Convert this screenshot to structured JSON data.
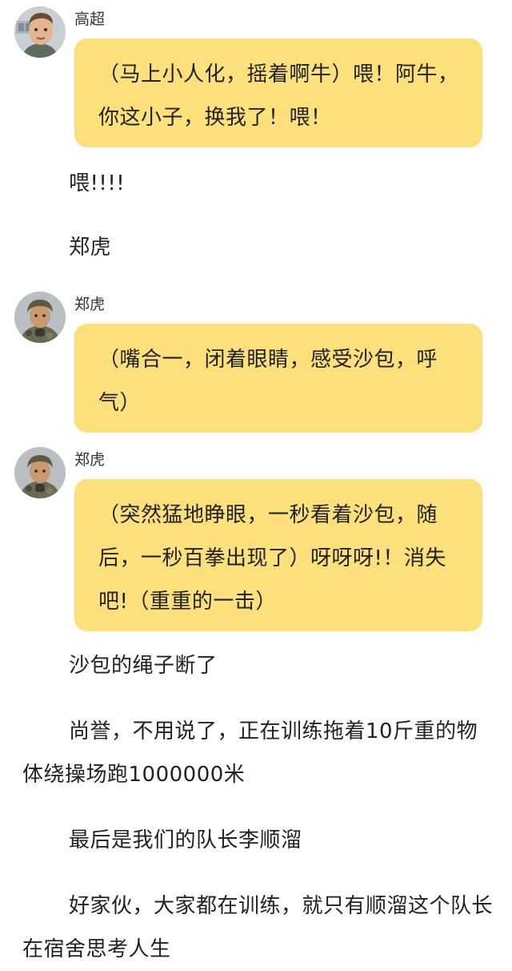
{
  "messages": [
    {
      "sender": "高超",
      "avatar_icon": "cartoon-boy-avatar-icon",
      "text": "（马上小人化，摇着啊牛）喂！阿牛，你这小子，换我了！喂！"
    },
    {
      "sender": "郑虎",
      "avatar_icon": "soldier-avatar-icon",
      "text": "（嘴合一，闭着眼睛，感受沙包，呼气）"
    },
    {
      "sender": "郑虎",
      "avatar_icon": "soldier-avatar-icon",
      "text": "（突然猛地睁眼，一秒看着沙包，随后，一秒百拳出现了）呀呀呀!！消失吧!（重重的一击）"
    }
  ],
  "paragraphs": {
    "p1": "喂!!!!",
    "p2": "郑虎",
    "p3": "沙包的绳子断了",
    "p4": "尚誉，不用说了，正在训练拖着10斤重的物体绕操场跑1000000米",
    "p5": "最后是我们的队长李顺溜",
    "p6": "好家伙，大家都在训练，就只有顺溜这个队长在宿舍思考人生"
  },
  "colors": {
    "bubble": "#fbe07c",
    "text": "#222222"
  }
}
